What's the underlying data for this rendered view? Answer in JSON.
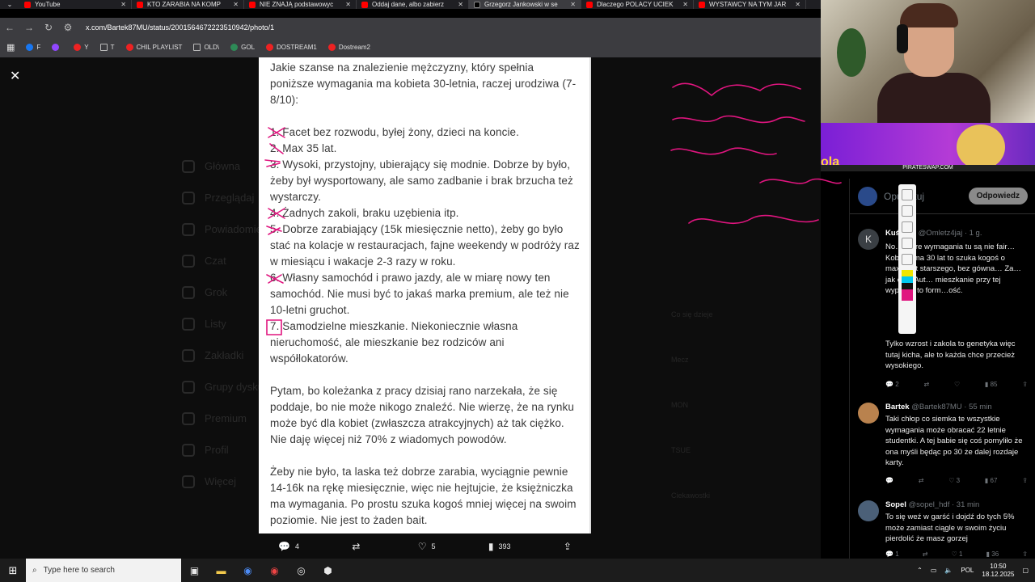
{
  "browser": {
    "tabs": [
      {
        "title": "YouTube",
        "favicon": "youtube-icon",
        "active": false
      },
      {
        "title": "KTO ZARABIA NA KOMP",
        "favicon": "youtube-icon",
        "active": false
      },
      {
        "title": "NIE ZNAJĄ podstawowyc",
        "favicon": "youtube-icon",
        "active": false
      },
      {
        "title": "Oddaj dane, albo zabierz",
        "favicon": "youtube-icon",
        "active": false
      },
      {
        "title": "Grzegorz Jankowski w se",
        "favicon": "x-icon",
        "active": true
      },
      {
        "title": "Dlaczego POLACY UCIEK",
        "favicon": "youtube-icon",
        "active": false
      },
      {
        "title": "WYSTAWCY NA TYM JAR",
        "favicon": "youtube-icon",
        "active": false
      }
    ],
    "url": "x.com/Bartek87MU/status/2001564672223510942/photo/1",
    "bookmarks": [
      {
        "label": "F",
        "icon": "facebook-icon"
      },
      {
        "label": "",
        "icon": "twitch-icon"
      },
      {
        "label": "Y",
        "icon": "youtube-icon"
      },
      {
        "label": "T",
        "icon": "x-icon"
      },
      {
        "label": "CHIL PLAYLIST",
        "icon": "youtube-icon"
      },
      {
        "label": "OLD\\",
        "icon": "folder-icon"
      },
      {
        "label": "GOL",
        "icon": "gol-icon"
      },
      {
        "label": "DOSTREAM1",
        "icon": "youtube-icon"
      },
      {
        "label": "Dostream2",
        "icon": "youtube-icon"
      }
    ]
  },
  "photo": {
    "paragraphs": [
      "Jakie szanse na znalezienie mężczyzny, który spełnia poniższe wymagania ma kobieta 30-letnia, raczej urodziwa (7-8/10):",
      "1. Facet bez rozwodu, byłej żony, dzieci na koncie.",
      "2. Max 35 lat.",
      "3. Wysoki, przystojny, ubierający się modnie. Dobrze by było, żeby był wysportowany, ale samo zadbanie i brak brzucha też wystarczy.",
      "4. Żadnych zakoli, braku uzębienia itp.",
      "5. Dobrze zarabiający (15k miesięcznie netto), żeby go było stać na kolacje w restauracjach, fajne weekendy w podróży raz w miesiącu i wakacje 2-3 razy w roku.",
      "6. Własny samochód i prawo jazdy, ale w miarę nowy ten samochód. Nie musi być to jakaś marka premium, ale też nie 10-letni gruchot.",
      "7. Samodzielne mieszkanie. Niekoniecznie własna nieruchomość, ale mieszkanie bez rodziców ani współlokatorów.",
      "Pytam, bo koleżanka z pracy dzisiaj rano narzekała, że się poddaje, bo nie może nikogo znaleźć. Nie wierzę, że na rynku może być dla kobiet (zwłaszcza atrakcyjnych) aż tak ciężko. Nie daję więcej niż 70% z wiadomych powodów.",
      "Żeby nie było, ta laska też dobrze zarabia, wyciągnie pewnie 14-16k na rękę miesięcznie, więc nie hejtujcie, że księżniczka ma wymagania. Po prostu szuka kogoś mniej więcej na swoim poziomie. Nie jest to żaden bait."
    ]
  },
  "actions": {
    "replies": "4",
    "reposts": "",
    "likes": "5",
    "views": "393"
  },
  "sidebar": {
    "reply_placeholder": "Opublikuj",
    "reply_button": "Odpowiedz",
    "tweets": [
      {
        "avatar_letter": "K",
        "name": "Kuś…45",
        "handle": "@Omletz4jaj · 1 g.",
        "text": "No… które wymagania tu są nie fair… Kobieta ma 30 lat to szuka kogoś o max… lat starszego, bez gówna… Za… jak ona. Aut… mieszkanie przy tej wypłacie to form…ość.",
        "text2": "Tylko wzrost i zakola to genetyka więc tutaj kicha, ale to każda chce przecież wysokiego.",
        "replies": "2",
        "reposts": "",
        "likes": "",
        "views": "85"
      },
      {
        "avatar_letter": "",
        "name": "Bartek",
        "handle": "@Bartek87MU · 55 min",
        "text": "Taki chłop co siemka te wszystkie wymagania może obracać 22 letnie studentki. A tej babie się coś pomyliło że ona myśli będąc po 30 że dalej rozdaje karty.",
        "replies": "",
        "reposts": "",
        "likes": "3",
        "views": "67"
      },
      {
        "avatar_letter": "",
        "name": "Sopel",
        "handle": "@sopel_hdf · 31 min",
        "text": "To się weź w garść i dojdź do tych 5% może zamiast ciągle w swoim życiu pierdolić że masz gorzej",
        "replies": "1",
        "reposts": "",
        "likes": "1",
        "views": "36"
      }
    ]
  },
  "stream": {
    "banner_text": "PIRATESWAP.COM",
    "banner_logo": "ola"
  },
  "taskbar": {
    "search_placeholder": "Type here to search",
    "language": "POL",
    "time": "10:50",
    "date": "18.12.2025"
  },
  "colors": {
    "annotation": "#e0157f",
    "link_blue": "#1d9bf0"
  }
}
